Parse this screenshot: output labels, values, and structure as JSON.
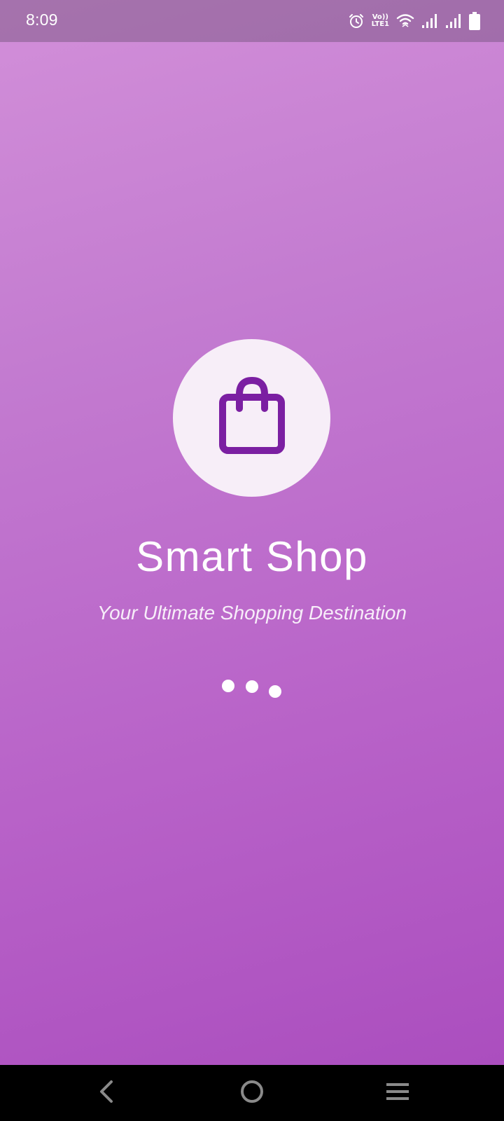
{
  "status_bar": {
    "time": "8:09",
    "icons": [
      "alarm-icon",
      "volte-lte1-icon",
      "wifi-icon",
      "signal-sim1-icon",
      "signal-sim2-icon",
      "battery-icon"
    ],
    "volte_label_top": "Vo))",
    "volte_label_bottom": "LTE1"
  },
  "splash": {
    "logo_icon": "shopping-bag-icon",
    "title": "Smart Shop",
    "tagline": "Your Ultimate Shopping Destination",
    "loader_dots": 3
  },
  "nav_bar": {
    "buttons": [
      "back-icon",
      "home-icon",
      "recents-icon"
    ]
  },
  "colors": {
    "gradient_start": "#d28fd9",
    "gradient_end": "#a94bbd",
    "logo_bg": "#f7eef8",
    "accent": "#7b1fa2",
    "text": "#ffffff"
  }
}
